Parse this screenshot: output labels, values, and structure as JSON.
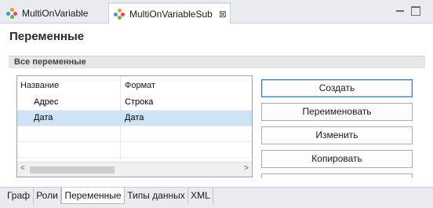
{
  "editor_tabs": [
    {
      "label": "MultiOnVariable",
      "active": false
    },
    {
      "label": "MultiOnVariableSub",
      "active": true,
      "close_glyph": "⊠"
    }
  ],
  "page": {
    "title": "Переменные",
    "section_title": "Все переменные"
  },
  "table": {
    "columns": [
      "Название",
      "Формат"
    ],
    "rows": [
      {
        "name": "Адрес",
        "format": "Строка",
        "selected": false
      },
      {
        "name": "Дата",
        "format": "Дата",
        "selected": true
      }
    ],
    "scroll_left": "<",
    "scroll_right": ">"
  },
  "buttons": {
    "create": "Создать",
    "rename": "Переименовать",
    "edit": "Изменить",
    "copy": "Копировать"
  },
  "bottom_tabs": [
    {
      "label": "Граф",
      "active": false
    },
    {
      "label": "Роли",
      "active": false
    },
    {
      "label": "Переменные",
      "active": true
    },
    {
      "label": "Типы данных",
      "active": false
    },
    {
      "label": "XML",
      "active": false
    }
  ],
  "colors": {
    "selection": "#cfe3f7",
    "primary_border": "#3c7fb1",
    "tabbar_bg": "#e9ecf0"
  },
  "icons": [
    "multi-process-icon",
    "close-icon",
    "minimize-icon",
    "maximize-icon"
  ]
}
